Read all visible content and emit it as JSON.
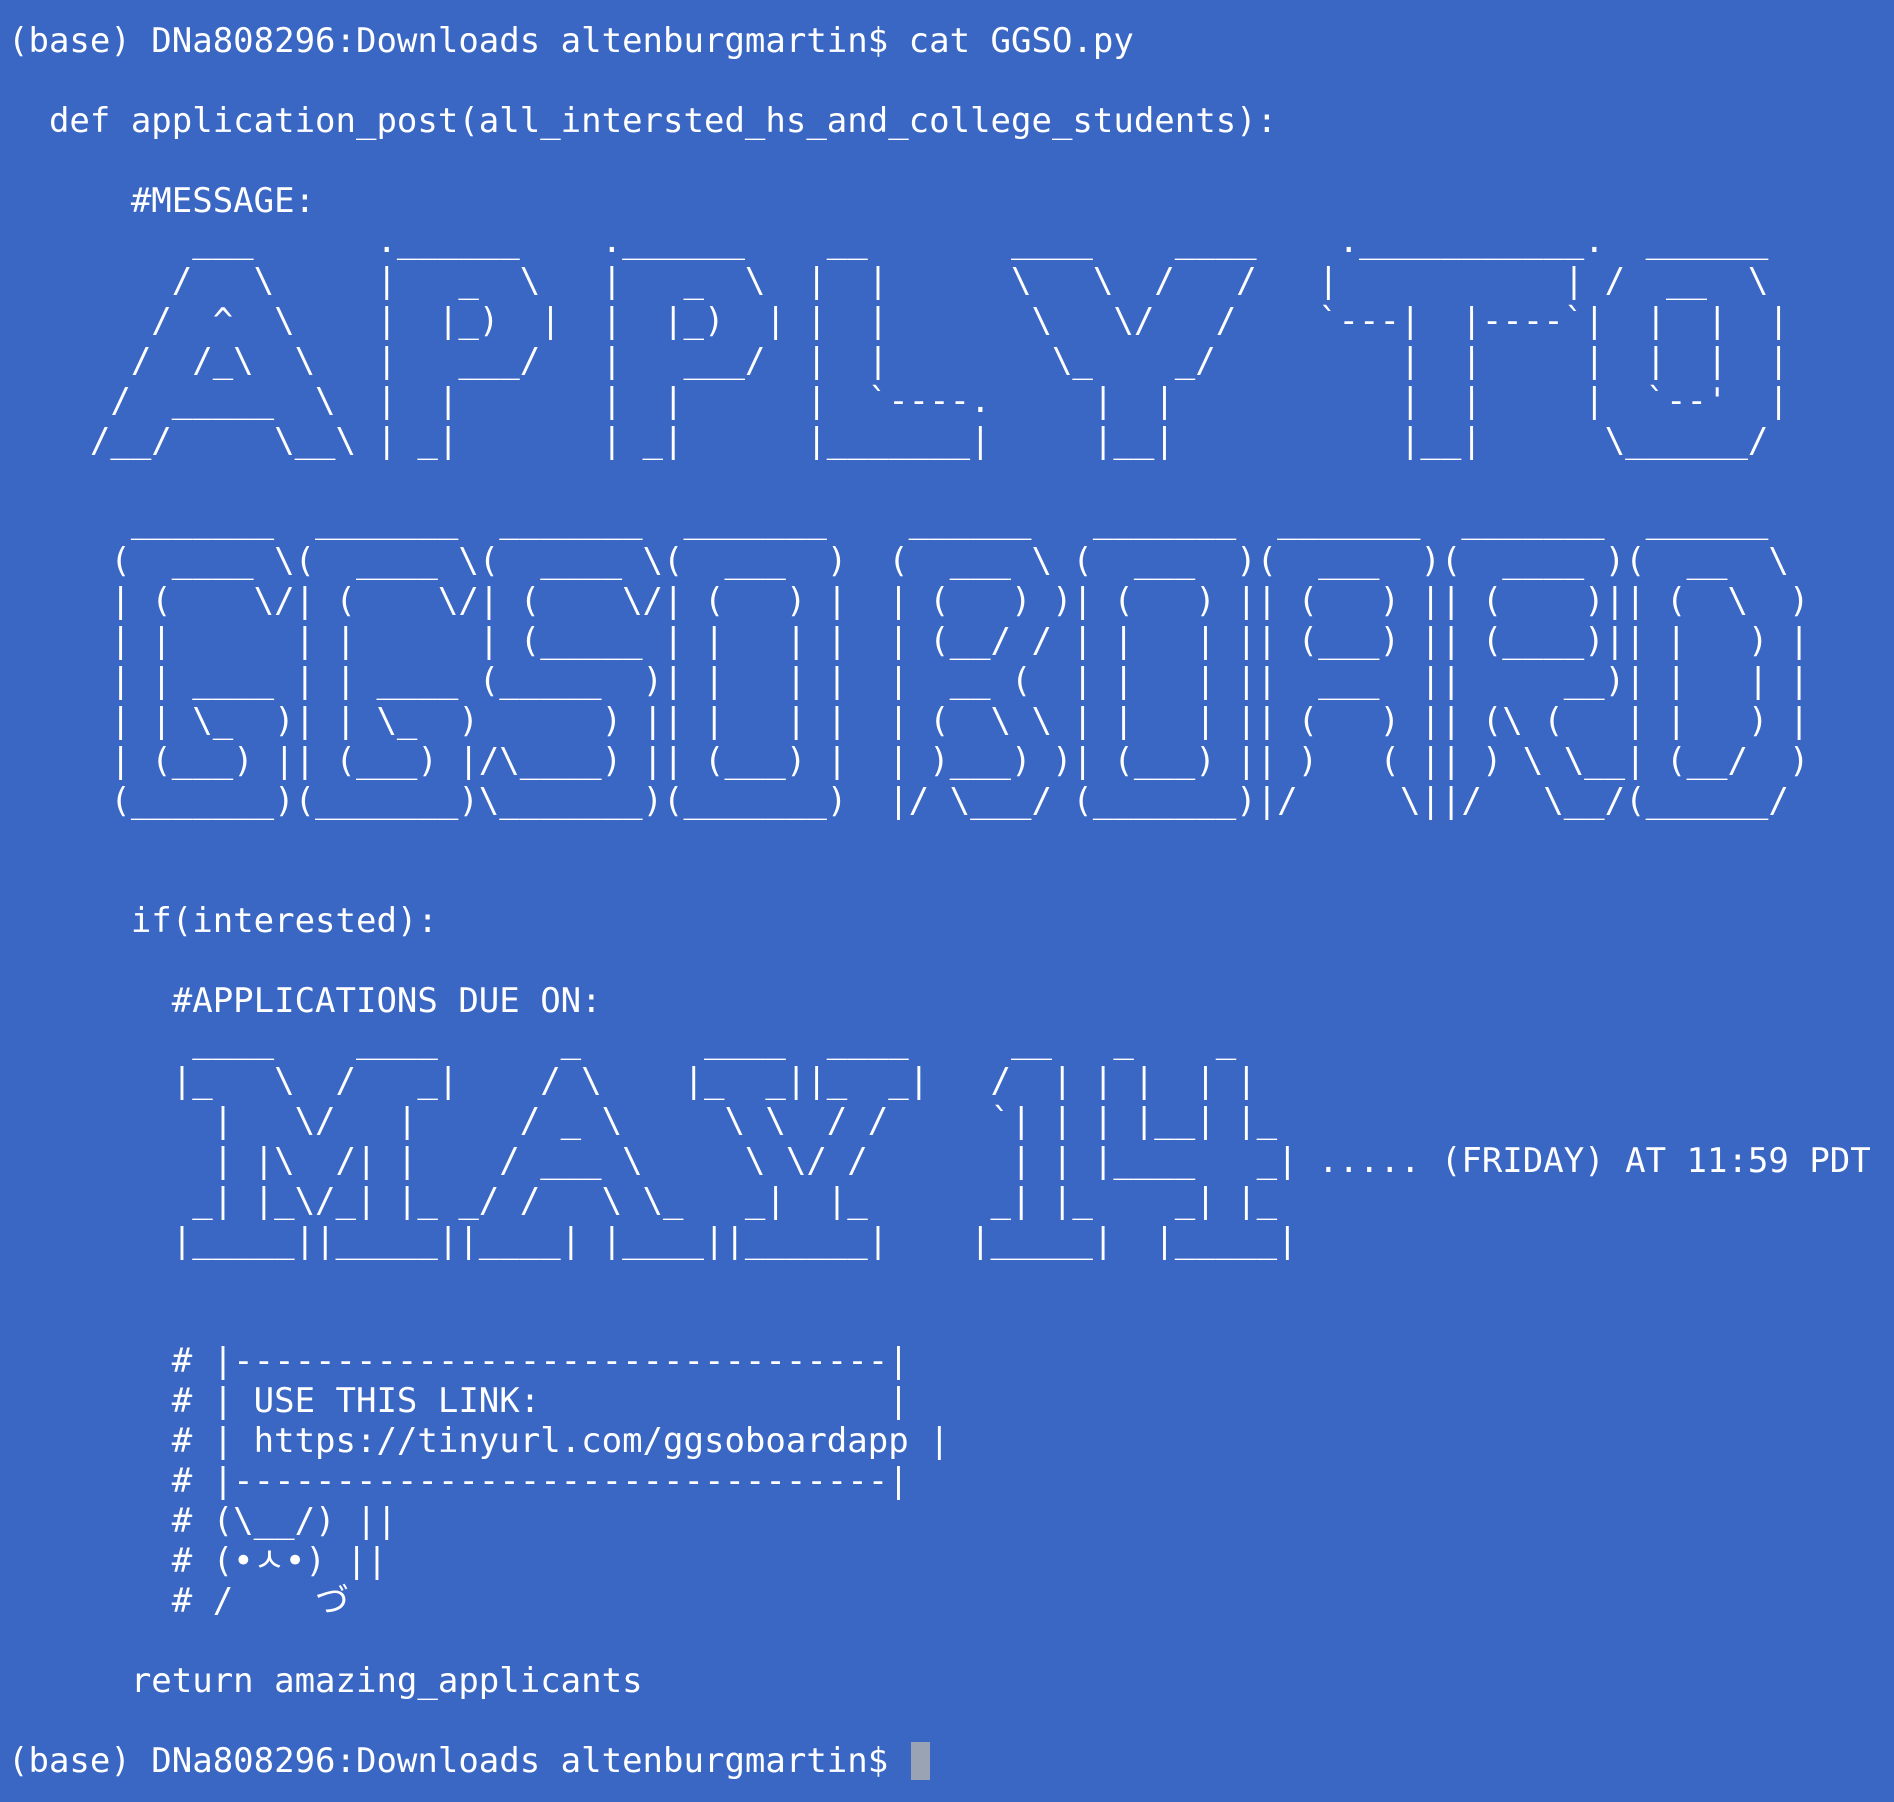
{
  "colors": {
    "background": "#3b67c4",
    "text": "#ffffff",
    "cursor": "#9aa3b3"
  },
  "terminal": {
    "lines": [
      "(base) DNa808296:Downloads altenburgmartin$ cat GGSO.py",
      "",
      "  def application_post(all_intersted_hs_and_college_students):",
      "",
      "      #MESSAGE:",
      "         ___      .______    .______    __       ____    ____    .___________.  ______ ",
      "        /   \\     |   _  \\   |   _  \\  |  |      \\   \\  /   /   |           | /  __  \\",
      "       /  ^  \\    |  |_)  |  |  |_)  | |  |       \\   \\/   /    `---|  |----`|  |  |  |",
      "      /  /_\\  \\   |   ___/   |   ___/  |  |        \\_    _/         |  |     |  |  |  |",
      "     /  _____  \\  |  |       |  |      |  `----.     |  |           |  |     |  `--'  |",
      "    /__/     \\__\\ | _|       | _|      |_______|     |__|           |__|      \\______/",
      "",
      "      _______  _______  _______  _______    ______   _______  _______  _______  ______",
      "     (  ____ \\(  ____ \\(  ____ \\(  ___  )  (  ___ \\ (  ___  )(  ___  )(  ____ )(  __  \\",
      "     | (    \\/| (    \\/| (    \\/| (   ) |  | (   ) )| (   ) || (   ) || (    )|| (  \\  )",
      "     | |      | |      | (_____ | |   | |  | (__/ / | |   | || (___) || (____)|| |   ) |",
      "     | | ____ | | ____ (_____  )| |   | |  |  __ (  | |   | ||  ___  ||     __)| |   | |",
      "     | | \\_  )| | \\_  )      ) || |   | |  | (  \\ \\ | |   | || (   ) || (\\ (   | |   ) |",
      "     | (___) || (___) |/\\____) || (___) |  | )___) )| (___) || )   ( || ) \\ \\__| (__/  )",
      "     (_______)(_______)\\_______)(_______)  |/ \\___/ (_______)|/     \\||/   \\__/(______/",
      "",
      "",
      "      if(interested):",
      "",
      "        #APPLICATIONS DUE ON:",
      "         ____    ____      _      ____  ____     __   _    _",
      "        |_   \\  /   _|    / \\    |_  _||_  _|   /  | | |  | |",
      "          |   \\/   |     / _ \\     \\ \\  / /     `| | | |__| |_",
      "          | |\\  /| |    / ___ \\     \\ \\/ /       | | |____   _| ..... (FRIDAY) AT 11:59 PDT",
      "         _| |_\\/_| |_ _/ /   \\ \\_   _|  |_      _| |_    _| |_",
      "        |_____||_____||____| |____||______|    |_____|  |_____|",
      "",
      "",
      "        # |--------------------------------|",
      "        # | USE THIS LINK:                 |",
      "        # | https://tinyurl.com/ggsoboardapp |",
      "        # |--------------------------------|",
      "        # (\\__/) ||",
      "        # (•ㅅ•) ||",
      "        # /    づ",
      "",
      "      return amazing_applicants",
      "",
      "(base) DNa808296:Downloads altenburgmartin$ "
    ]
  }
}
